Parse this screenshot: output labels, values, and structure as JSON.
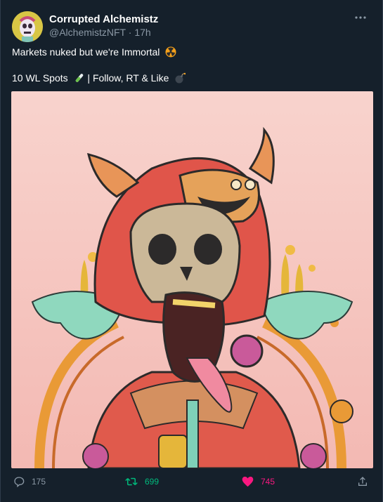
{
  "tweet": {
    "display_name": "Corrupted Alchemistz",
    "handle": "@AlchemistzNFT",
    "separator": " · ",
    "time": "17h",
    "more_icon": "more-horizontal-icon",
    "line1": "Markets nuked but we're Immortal",
    "line1_emoji": "radioactive-icon",
    "line2_part1": "10 WL Spots",
    "line2_emoji1": "test-tube-icon",
    "line2_part2": " | Follow, RT & Like",
    "line2_emoji2": "bomb-icon",
    "media_description_icon": "artwork-image",
    "colors": {
      "background": "#15202b",
      "muted": "#8b98a5",
      "retweet": "#00ba7c",
      "like": "#f91880",
      "artwork_bg": "#f7c9c4"
    }
  },
  "actions": {
    "reply_count": "175",
    "retweet_count": "699",
    "like_count": "745"
  }
}
